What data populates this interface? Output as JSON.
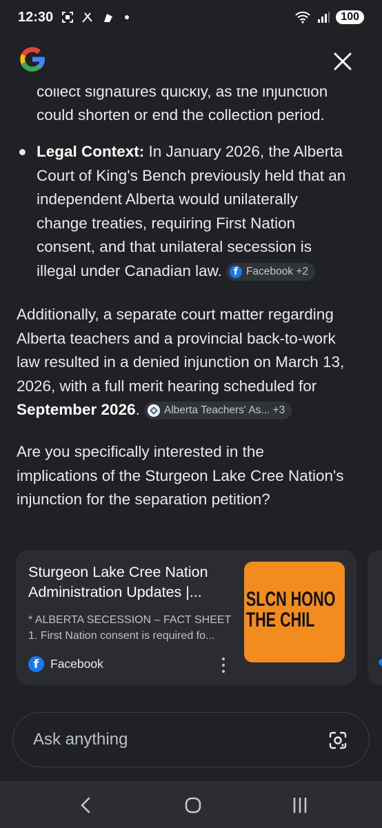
{
  "status_bar": {
    "time": "12:30",
    "battery": "100"
  },
  "header": {
    "logo_name": "google-g-logo",
    "close_icon": "close-icon"
  },
  "content": {
    "partial_line_top": "collect signatures quickly, as the injunction",
    "partial_line_2": "could shorten or end the collection period.",
    "bullet_label": "Legal Context:",
    "bullet_text_1": " In January 2026, the Alberta",
    "bullet_text_2": "Court of King's Bench previously held that an",
    "bullet_text_3": "independent Alberta would unilaterally",
    "bullet_text_4": "change treaties, requiring First Nation",
    "bullet_text_5": "consent, and that unilateral secession is",
    "bullet_text_6": "illegal under Canadian law.",
    "chip_1": "Facebook +2",
    "para_1_line_1": "Additionally, a separate court matter regarding",
    "para_1_line_2": "Alberta teachers and a provincial back-to-work",
    "para_1_line_3": "law resulted in a denied injunction on March 13,",
    "para_1_line_4": "2026, with a full merit hearing scheduled for",
    "para_1_bold": "September 2026",
    "para_1_end": ".",
    "chip_2": "Alberta Teachers' As... +3",
    "question_line_1": "Are you specifically interested in the",
    "question_line_2": "implications of the Sturgeon Lake Cree Nation's",
    "question_line_3": "injunction for the separation petition?"
  },
  "card": {
    "title_line_1": "Sturgeon Lake Cree Nation",
    "title_line_2": "Administration Updates |...",
    "snippet_line_1": "* ALBERTA SECESSION – FACT SHEET",
    "snippet_line_2": "1. First Nation consent is required fo...",
    "source": "Facebook",
    "thumb_line_1": "SLCN HONO",
    "thumb_line_2": "THE CHIL"
  },
  "input": {
    "placeholder": "Ask anything"
  },
  "colors": {
    "background": "#1f2125",
    "card": "#2a2c31",
    "facebook": "#1877f2",
    "thumb": "#f28c1e"
  }
}
